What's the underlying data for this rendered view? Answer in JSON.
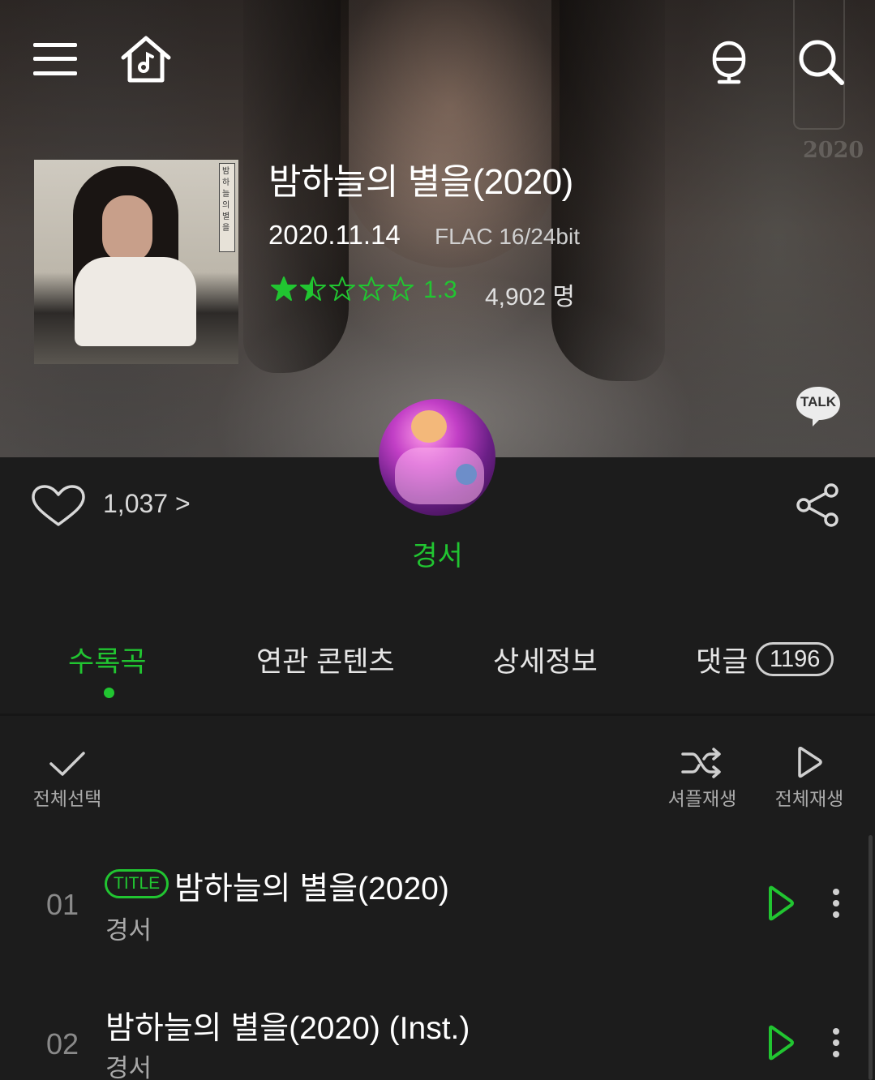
{
  "header": {
    "menu_icon": "hamburger-menu-icon",
    "home_icon": "music-home-icon",
    "mic_icon": "microphone-icon",
    "search_icon": "search-icon"
  },
  "album": {
    "title": "밤하늘의 별을(2020)",
    "release_date": "2020.11.14",
    "quality": "FLAC 16/24bit",
    "rating": 1.3,
    "rating_score": "1.3",
    "rating_count": "4,902 명",
    "cover_year": "2020",
    "cover_text": "밤하늘의별을"
  },
  "talk": {
    "label": "TALK"
  },
  "artist": {
    "name": "경서"
  },
  "likes": {
    "count": "1,037 >"
  },
  "tabs": [
    {
      "label": "수록곡",
      "active": true
    },
    {
      "label": "연관 콘텐츠",
      "active": false
    },
    {
      "label": "상세정보",
      "active": false
    },
    {
      "label": "댓글",
      "active": false,
      "count": "1196"
    }
  ],
  "toolbar": {
    "select_all": "전체선택",
    "shuffle_play": "셔플재생",
    "play_all": "전체재생"
  },
  "tracks": [
    {
      "number": "01",
      "badge": "TITLE",
      "title": "밤하늘의 별을(2020)",
      "artist": "경서"
    },
    {
      "number": "02",
      "badge": "",
      "title": "밤하늘의 별을(2020) (Inst.)",
      "artist": "경서"
    }
  ],
  "colors": {
    "accent": "#21c531",
    "background": "#1c1c1c",
    "text_primary": "#ffffff",
    "text_secondary": "#a8a8a8"
  }
}
